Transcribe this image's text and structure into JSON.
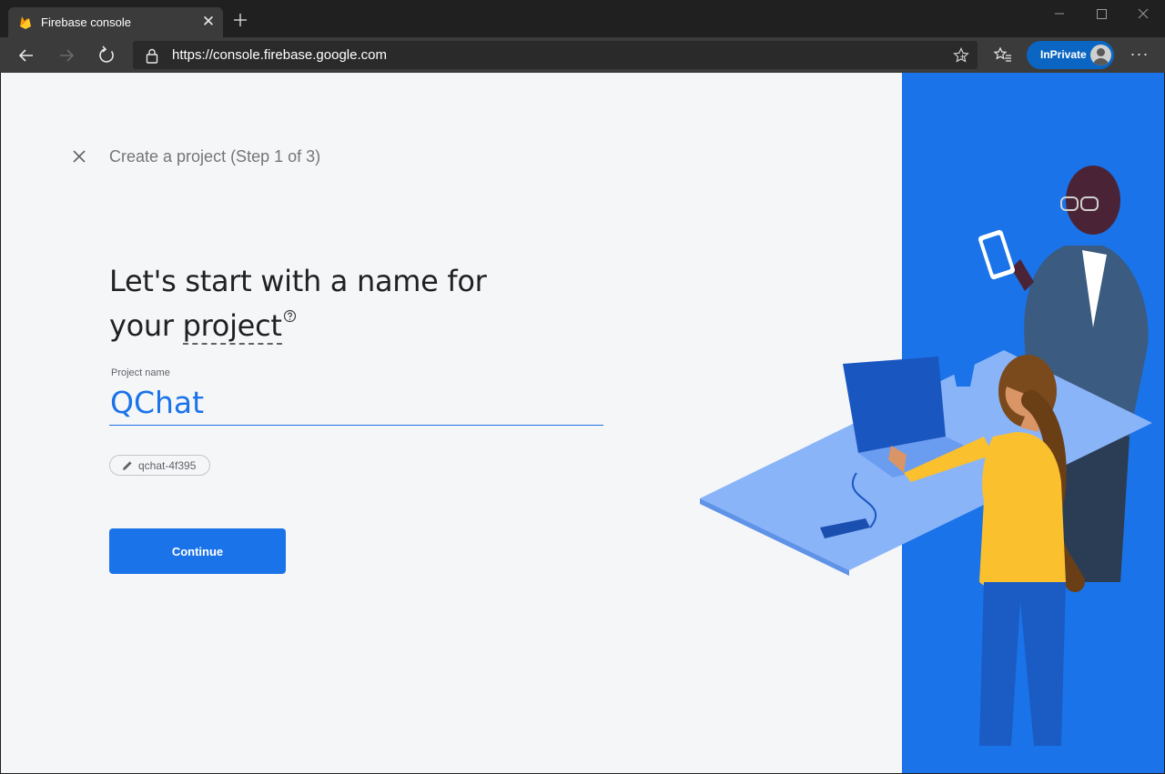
{
  "browser": {
    "tab": {
      "title": "Firebase console",
      "favicon": "firebase-flame-icon"
    },
    "address": {
      "scheme": "https://",
      "host": "console.firebase.google.com"
    },
    "inprivate_label": "InPrivate",
    "menu_glyph": "···"
  },
  "dialog": {
    "step_title": "Create a project (Step 1 of 3)",
    "heading_part1": "Let's start with a name for",
    "heading_part2": "your",
    "heading_keyword": "project",
    "field": {
      "label": "Project name",
      "value": "QChat"
    },
    "project_id": "qchat-4f395",
    "continue_label": "Continue"
  },
  "colors": {
    "accent": "#1a73e8",
    "illustration_panel": "#1a73e8",
    "page_background": "#f5f6f8"
  }
}
